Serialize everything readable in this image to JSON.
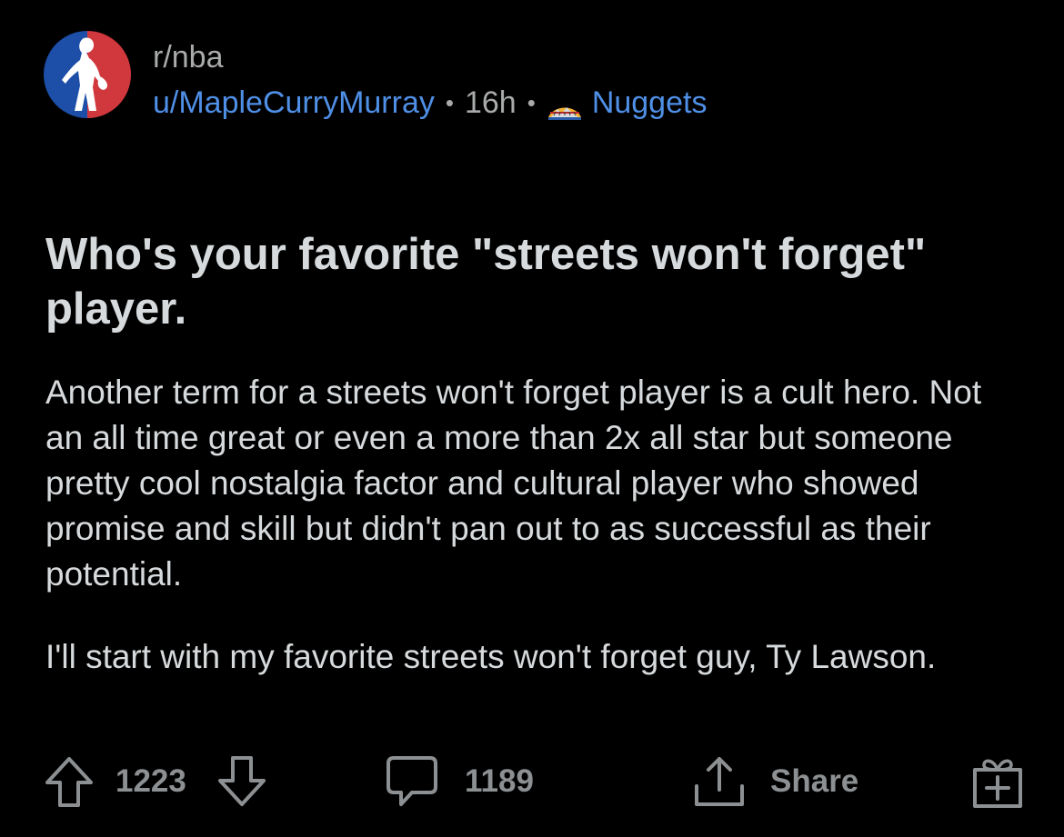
{
  "header": {
    "subreddit": "r/nba",
    "username": "u/MapleCurryMurray",
    "separator": "•",
    "age": "16h",
    "flair": "Nuggets",
    "avatar_icon": "nba-logo-icon",
    "flair_icon": "nuggets-mountains-icon"
  },
  "post": {
    "title": "Who's your favorite \"streets won't forget\" player.",
    "body": [
      "Another term for a streets won't forget player is a cult hero. Not an all time great or even a more than 2x all star but someone pretty cool nostalgia factor and cultural player who showed promise and skill but didn't pan out to as successful as their potential.",
      "I'll start with my favorite streets won't forget guy,  Ty Lawson."
    ]
  },
  "footer": {
    "upvotes": "1223",
    "comments": "1189",
    "share_label": "Share"
  },
  "colors": {
    "background": "#000000",
    "text": "#d7dadc",
    "muted": "#a8aaab",
    "link": "#4f8fe6",
    "icon": "#8d9092"
  }
}
